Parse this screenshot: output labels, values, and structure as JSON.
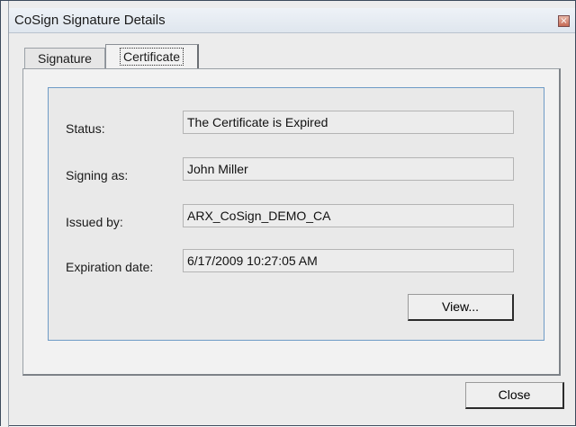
{
  "window": {
    "title": "CoSign Signature Details",
    "close_glyph": "×"
  },
  "tabs": [
    {
      "label": "Signature",
      "selected": false
    },
    {
      "label": "Certificate",
      "selected": true
    }
  ],
  "certificate": {
    "rows": [
      {
        "label": "Status:",
        "value": "The Certificate is Expired"
      },
      {
        "label": "Signing as:",
        "value": "John Miller"
      },
      {
        "label": "Issued by:",
        "value": "ARX_CoSign_DEMO_CA"
      },
      {
        "label": "Expiration date:",
        "value": "6/17/2009 10:27:05 AM"
      }
    ],
    "view_label": "View..."
  },
  "footer": {
    "close_label": "Close"
  },
  "colors": {
    "group_border": "#6e9bc6",
    "close_box": "#c66a55"
  }
}
